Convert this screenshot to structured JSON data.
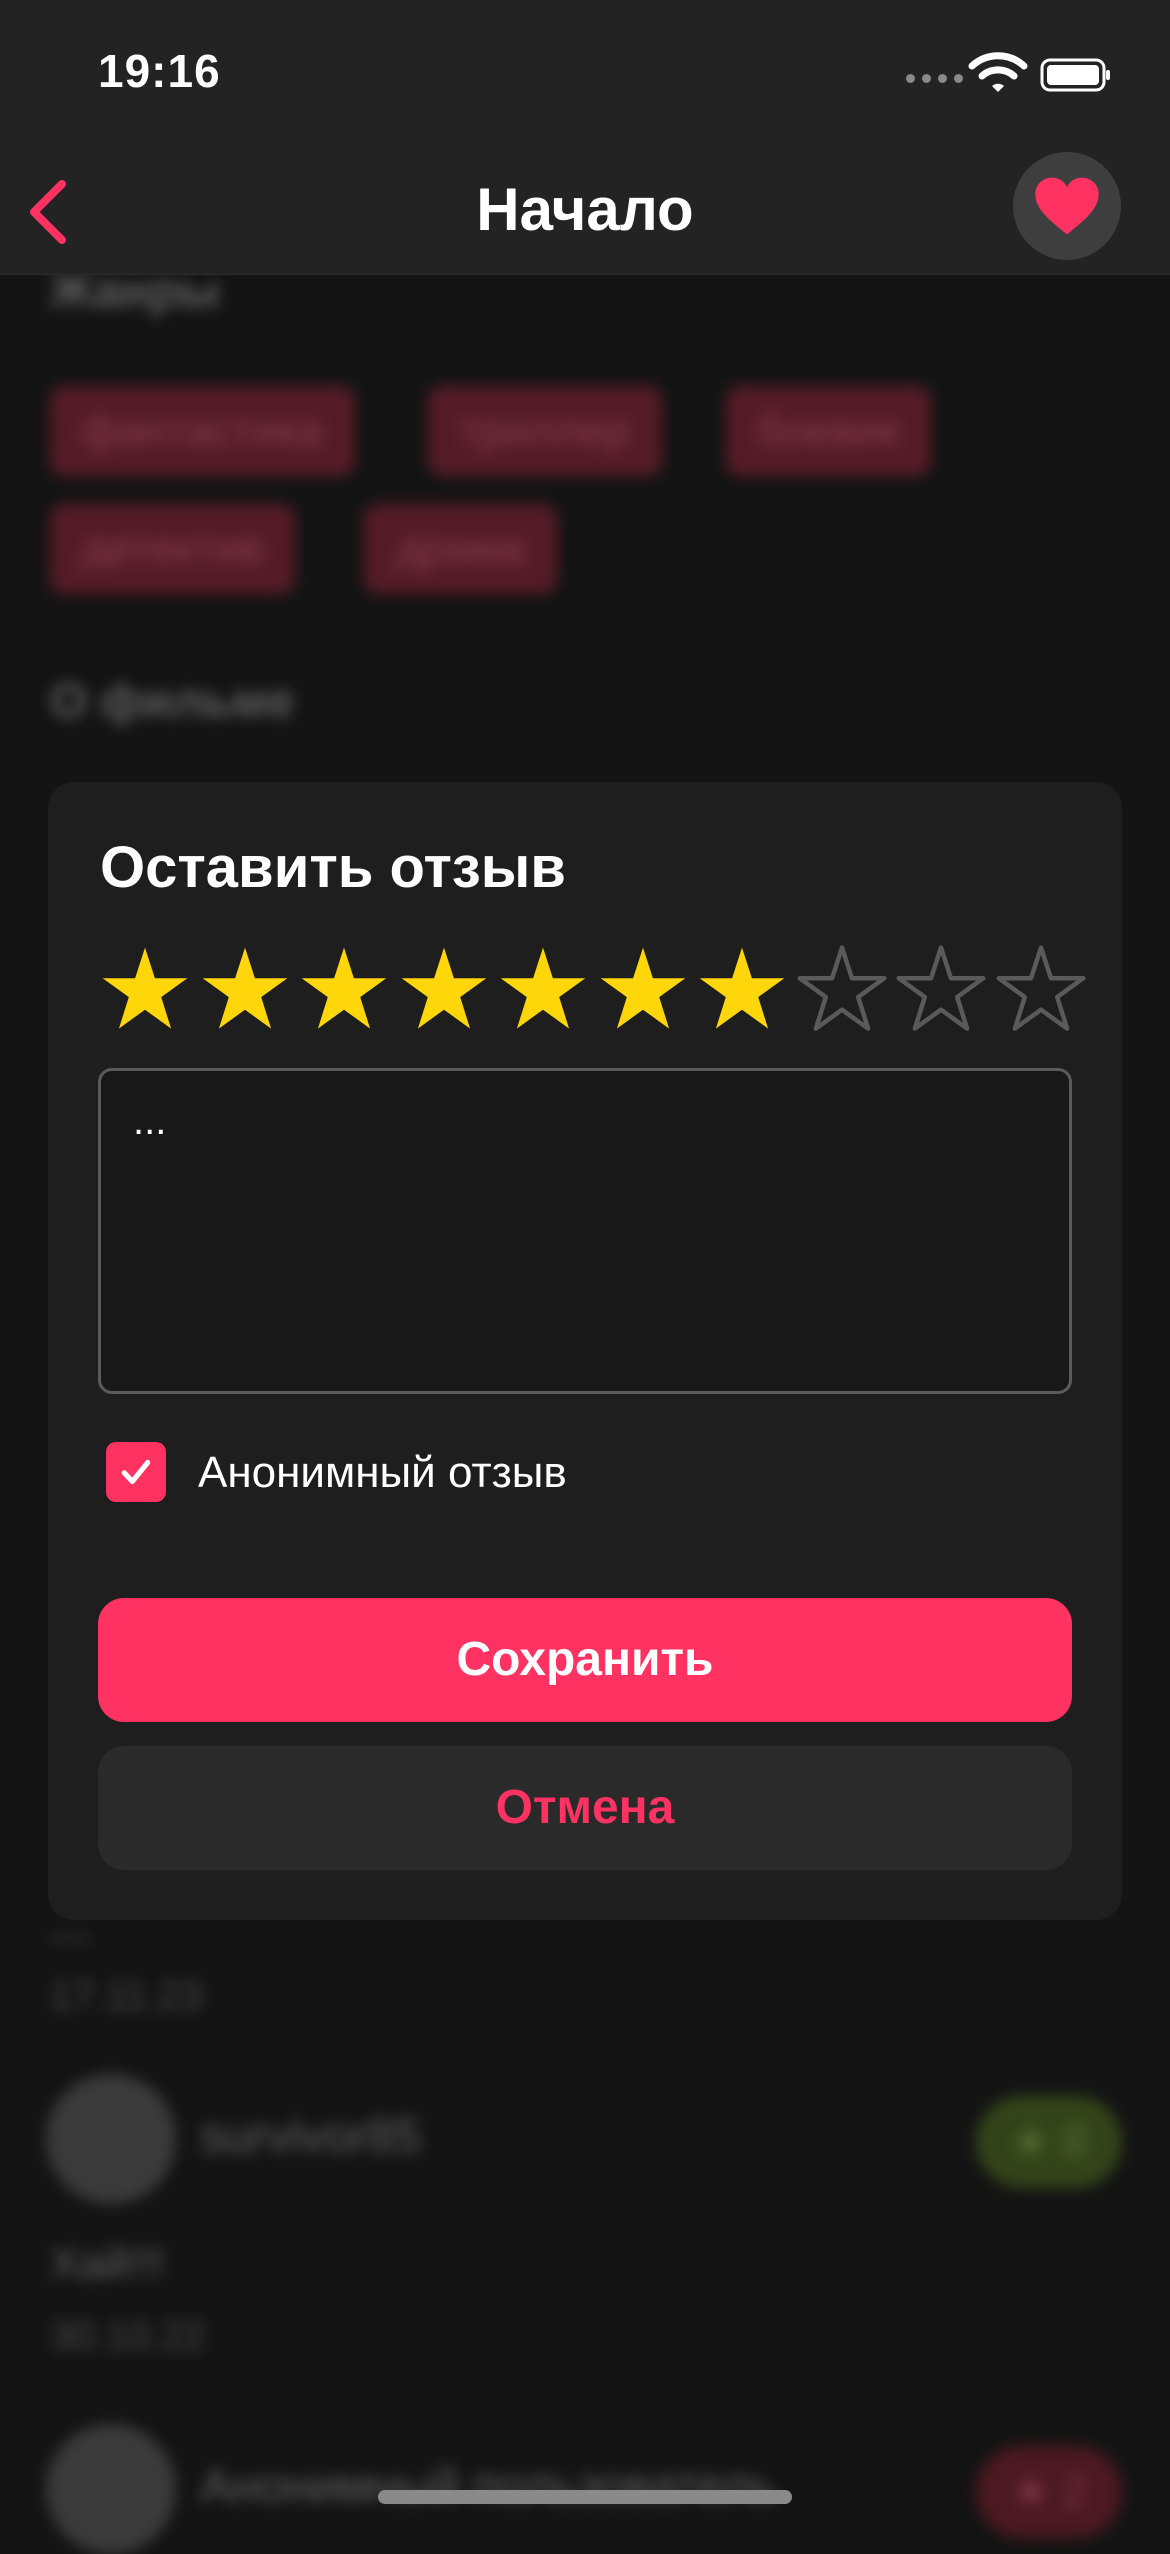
{
  "status_bar": {
    "time": "19:16",
    "icons": [
      "signal-icon",
      "wifi-icon",
      "battery-icon"
    ]
  },
  "nav": {
    "title": "Начало",
    "back_icon": "chevron-left-icon",
    "favorite_icon": "heart-icon"
  },
  "background": {
    "genres_heading": "Жанры",
    "genres": [
      "фантастика",
      "триллер",
      "боевик",
      "детектив",
      "драма"
    ],
    "about_heading": "О фильме",
    "reviews": [
      {
        "text": "—",
        "date": "17.11.23"
      },
      {
        "author": "survivor85",
        "text": "Хай!!!",
        "date": "30.10.22",
        "rating": "★ 8"
      },
      {
        "author": "Анонимный пользователь",
        "rating": "★ 2"
      }
    ]
  },
  "review_dialog": {
    "title": "Оставить отзыв",
    "rating": 7,
    "rating_max": 10,
    "input_value": "...",
    "anonymous_checked": true,
    "anonymous_label": "Анонимный отзыв",
    "save_label": "Сохранить",
    "cancel_label": "Отмена"
  },
  "colors": {
    "accent": "#ff3262",
    "star_filled": "#ffd60a",
    "star_empty": "#5a5a5a",
    "background": "#141414",
    "card": "#1e1e1e",
    "bar": "#232323"
  }
}
